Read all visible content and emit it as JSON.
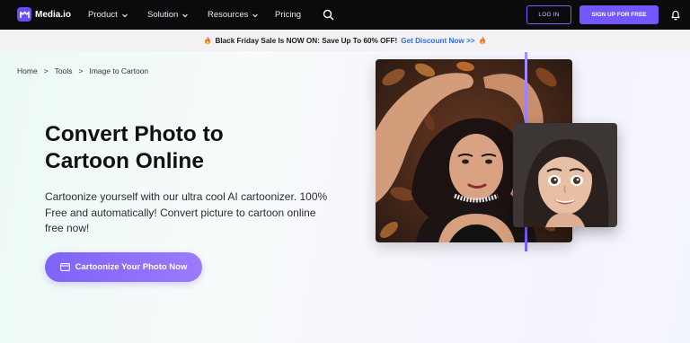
{
  "nav": {
    "brand": "Media.io",
    "items": [
      {
        "label": "Product",
        "has_dropdown": true
      },
      {
        "label": "Solution",
        "has_dropdown": true
      },
      {
        "label": "Resources",
        "has_dropdown": true
      },
      {
        "label": "Pricing",
        "has_dropdown": false
      }
    ],
    "login_label": "LOG IN",
    "signup_label": "SIGN UP FOR FREE",
    "icons": [
      "search-icon",
      "bell-icon"
    ]
  },
  "promo": {
    "text": "Black Friday Sale Is NOW ON: Save Up To 60% OFF!",
    "link": "Get Discount Now >>"
  },
  "breadcrumb": [
    "Home",
    ">",
    "Tools",
    ">",
    "Image to Cartoon"
  ],
  "hero": {
    "title_line1": "Convert Photo to",
    "title_line2": "Cartoon Online",
    "description": "Cartoonize yourself with our ultra cool AI cartoonizer. 100% Free and automatically! Convert picture to cartoon online free now!",
    "cta_label": "Cartoonize Your Photo Now"
  },
  "colors": {
    "nav_bg": "#0b0b0d",
    "accent": "#7557ff",
    "promo_link": "#2f6df2"
  }
}
